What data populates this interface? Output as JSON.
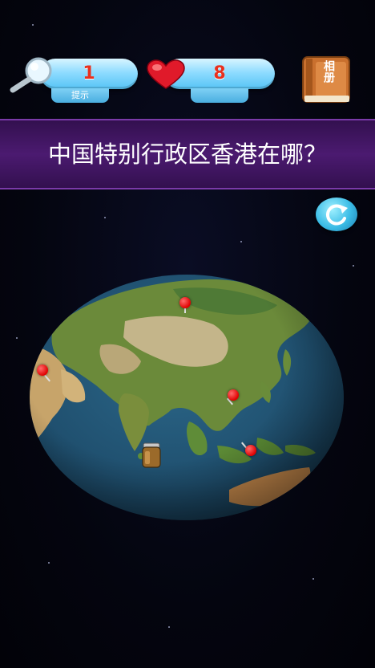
{
  "hud": {
    "hint_count": "1",
    "hint_label": "提示",
    "lives_count": "8",
    "album_label": "相册"
  },
  "question": "中国特别行政区香港在哪？",
  "icons": {
    "hint": "magnifier-icon",
    "lives": "heart-icon",
    "album": "book-icon",
    "refresh": "refresh-icon",
    "item": "jar-icon"
  },
  "colors": {
    "question_bar": "#4b1a70",
    "hud_pill": "#8fdcff",
    "hud_number": "#e8301e",
    "pin": "#e00000",
    "ocean": "#1f4f6e"
  }
}
